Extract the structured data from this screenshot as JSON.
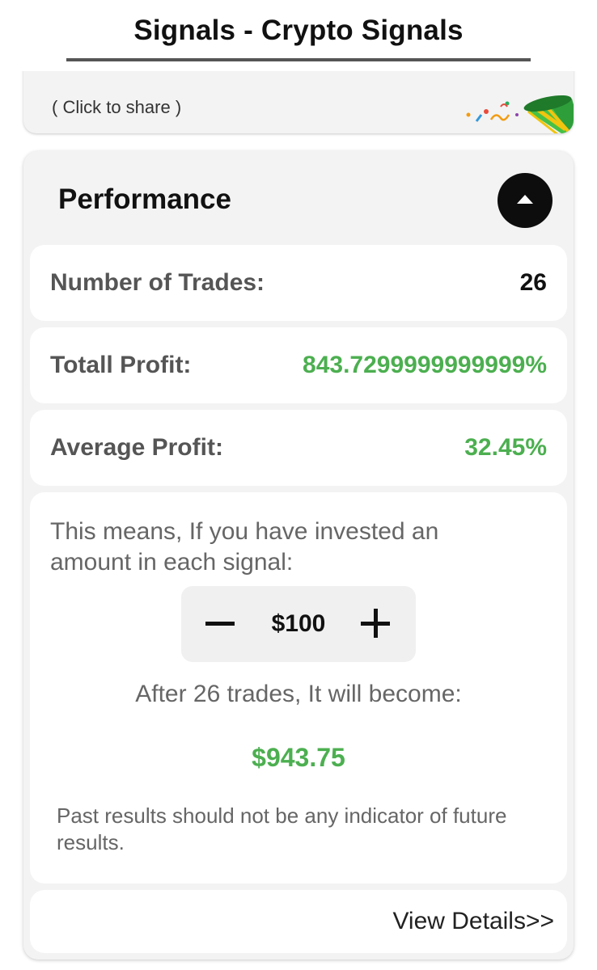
{
  "header": {
    "title": "Signals - Crypto Signals"
  },
  "share_card": {
    "share_text": "( Click to share )",
    "icon": "party-popper-icon"
  },
  "performance": {
    "title": "Performance",
    "collapse_icon": "caret-up-icon",
    "rows": [
      {
        "label": "Number of Trades:",
        "value": "26"
      },
      {
        "label": "Totall Profit:",
        "value": "843.7299999999999%"
      },
      {
        "label": "Average Profit:",
        "value": "32.45%"
      }
    ],
    "invest": {
      "intro": "This means, If you have invested an amount in each signal:",
      "amount": "$100",
      "after_text": "After 26 trades, It will become:",
      "result": "$943.75",
      "disclaimer": "Past results should not be any indicator of future results."
    },
    "view_details": "View Details>>"
  },
  "colors": {
    "accent_green": "#4caf50",
    "card_background": "#f3f3f3",
    "text_dark": "#111111",
    "text_gray": "#666666"
  }
}
